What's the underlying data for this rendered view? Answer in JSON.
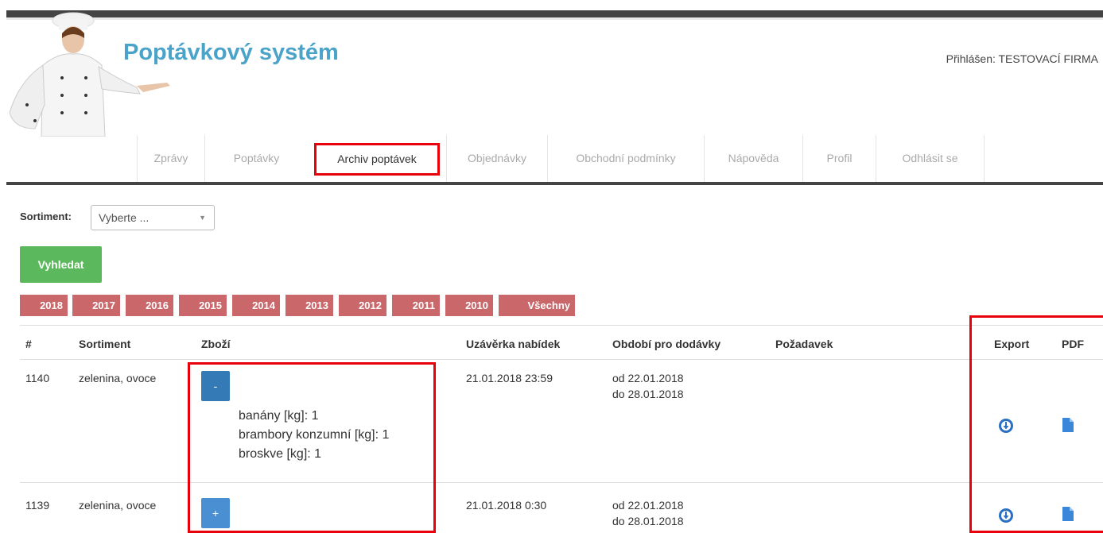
{
  "header": {
    "title": "Poptávkový systém",
    "user": "Přihlášen: TESTOVACÍ FIRMA"
  },
  "nav": {
    "items": [
      {
        "label": "Zprávy"
      },
      {
        "label": "Poptávky"
      },
      {
        "label": "Archiv poptávek",
        "active": true
      },
      {
        "label": "Objednávky"
      },
      {
        "label": "Obchodní podmínky"
      },
      {
        "label": "Nápověda"
      },
      {
        "label": "Profil"
      },
      {
        "label": "Odhlásit se"
      }
    ]
  },
  "filter": {
    "sortiment_label": "Sortiment:",
    "sortiment_value": "Vyberte ...",
    "search_label": "Vyhledat"
  },
  "years": [
    "2018",
    "2017",
    "2016",
    "2015",
    "2014",
    "2013",
    "2012",
    "2011",
    "2010",
    "Všechny"
  ],
  "table": {
    "headers": {
      "id": "#",
      "sortiment": "Sortiment",
      "zbozi": "Zboží",
      "uzaverka": "Uzávěrka nabídek",
      "obdobi": "Období pro dodávky",
      "pozadavek": "Požadavek",
      "export": "Export",
      "pdf": "PDF"
    },
    "rows": [
      {
        "id": "1140",
        "sortiment": "zelenina, ovoce",
        "toggle": "-",
        "items": [
          "banány [kg]: 1",
          "brambory konzumní [kg]: 1",
          "broskve [kg]: 1"
        ],
        "uzaverka": "21.01.2018 23:59",
        "obdobi_od": "od 22.01.2018",
        "obdobi_do": "do 28.01.2018"
      },
      {
        "id": "1139",
        "sortiment": "zelenina, ovoce",
        "toggle": "+",
        "uzaverka": "21.01.2018 0:30",
        "obdobi_od": "od 22.01.2018",
        "obdobi_do": "do 28.01.2018"
      }
    ]
  },
  "colors": {
    "title": "#4aa3c8",
    "year_button": "#c9676a",
    "search_button": "#5cb85c",
    "toggle": "#337ab7",
    "highlight": "#e8000b"
  }
}
